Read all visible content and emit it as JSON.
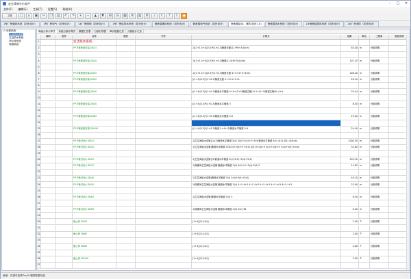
{
  "window": {
    "title": "宏业清单计价软件"
  },
  "menu": [
    "文件(F)",
    "编辑(E)",
    "工具(T)",
    "设置(S)",
    "帮助(H)"
  ],
  "toolbar": {
    "first_label": "工程",
    "buttons": [
      "new-icon",
      "open-icon",
      "save-icon",
      "cut-icon",
      "copy-icon",
      "paste-icon",
      "undo-icon",
      "redo-icon",
      "insert-row-icon",
      "delete-row-icon",
      "move-up-icon",
      "move-down-icon",
      "expand-icon",
      "collapse-icon",
      "calculator-icon",
      "report-icon",
      "chart-icon",
      "settings-icon",
      "search-icon",
      "pointer-icon",
      "help-icon",
      "export-icon",
      "orange-tool-icon"
    ]
  },
  "project_tabs": [
    {
      "label": "1号厂房通风系统（初步设计）",
      "active": false
    },
    {
      "label": "1号厂房电气（初步设计）",
      "active": false
    },
    {
      "label": "1#厂房照明（初步设计）",
      "active": false
    },
    {
      "label": "1号厂房给排水系统（初步设计）",
      "active": false
    },
    {
      "label": "宿舍楼通风系统（初步设计）",
      "active": false
    },
    {
      "label": "宿舍楼电气系统（初步设计）",
      "active": false
    },
    {
      "label": "宿舍楼给水、消防(初步1.0)",
      "active": true
    },
    {
      "label": "宿舍楼排水系统（初步设计）",
      "active": false
    },
    {
      "label": "2#宿舍楼排风系统（初步设计）",
      "active": false
    },
    {
      "label": "2#厂房消防（初步设计）",
      "active": false
    }
  ],
  "tree": [
    {
      "label": "分部系统",
      "level": 0,
      "selected": false
    },
    {
      "label": "生活给水系统",
      "level": 1,
      "selected": true
    },
    {
      "label": "生活热水系统",
      "level": 1,
      "selected": false
    },
    {
      "label": "消火栓系统",
      "level": 1,
      "selected": false
    },
    {
      "label": "喷淋系统",
      "level": 1,
      "selected": false
    }
  ],
  "sub_tabs": [
    {
      "label": "明细分部计算式",
      "active": true
    },
    {
      "label": "系统分部计算式",
      "active": false
    },
    {
      "label": "数据汇总表",
      "active": false
    },
    {
      "label": "分部分项表",
      "active": false
    },
    {
      "label": "单价措施汇总",
      "active": false
    },
    {
      "label": "分部统计汇总",
      "active": false
    }
  ],
  "columns": [
    "",
    "编码",
    "图号",
    "名称",
    "楼层",
    "代号",
    "计算式",
    "结果",
    "单位",
    "工程量",
    "图纸说明"
  ],
  "rows": [
    {
      "n": "1",
      "name": "生活给水系统",
      "name_style": "red",
      "formula": "",
      "result": "",
      "unit": "",
      "qty": ""
    },
    {
      "n": "2",
      "name": "PP-R管管道安装 DN15",
      "name_style": "green",
      "formula": "1[(1+1.5+4)/2.5]*(1+0.3)管道长度(2) 5*6+3(5)(m)",
      "result": "85.40",
      "unit": "m",
      "qty": "分部说明"
    },
    {
      "n": "3",
      "name": "",
      "name_style": "",
      "formula": "",
      "result": "",
      "unit": "",
      "qty": ""
    },
    {
      "n": "4",
      "name": "PP-R管管道安装 DN20",
      "name_style": "green",
      "formula": "1[(1+1.5+4)/2.5]*(1+0.3)管道(1) 5(6+3(4))(m)",
      "result": "107.25",
      "unit": "m",
      "qty": "分部说明"
    },
    {
      "n": "5",
      "name": "",
      "name_style": "",
      "formula": "",
      "result": "",
      "unit": "",
      "qty": ""
    },
    {
      "n": "6",
      "name": "PP-R管管道安装 DN25",
      "name_style": "green",
      "formula": "1[(1+1.5+4)/2.5]*(1+0.3)管道长度 4+4+4+4+4(m)",
      "result": "100.40",
      "unit": "m",
      "qty": "分部说明"
    },
    {
      "n": "7",
      "name": "PP-R管管道安装 DN32",
      "name_style": "green",
      "formula": "[(1+4)/2.5]*(1+0.3)管道长度 4+4+4+4+4",
      "result": "28.70",
      "unit": "m",
      "qty": "分部说明"
    },
    {
      "n": "8",
      "name": "",
      "name_style": "",
      "formula": "",
      "result": "",
      "unit": "",
      "qty": ""
    },
    {
      "n": "9",
      "name": "PP-R管管道安装 DN40",
      "name_style": "green",
      "formula": "[(1+4)/2.5]*(1+0.3)管道水平管道 4+4+(5+3)管道立管(3) 3+(5+3)管道立管(8) 4+4",
      "result": "35.44",
      "unit": "m",
      "qty": "分部说明"
    },
    {
      "n": "10",
      "name": "",
      "name_style": "",
      "formula": "",
      "result": "",
      "unit": "",
      "qty": ""
    },
    {
      "n": "11",
      "name": "PP-R管管道安装 DN50",
      "name_style": "green",
      "formula": "[(1+4)/2.5]*(1+0.3)管道水平管道 3",
      "result": "8.50",
      "unit": "m",
      "qty": "分部说明"
    },
    {
      "n": "12",
      "name": "",
      "name_style": "",
      "formula": "",
      "result": "",
      "unit": "",
      "qty": ""
    },
    {
      "n": "13",
      "name": "PP-R管管道安装 DN65",
      "name_style": "green",
      "formula": "[(1+4)/2.5]*(1+0.3)管道水平管道 5.6",
      "result": "23.40",
      "unit": "m",
      "qty": "分部说明"
    },
    {
      "n": "14",
      "name": "",
      "name_style": "",
      "formula": "",
      "result": "",
      "unit": "",
      "qty": "",
      "highlight": true
    },
    {
      "n": "15",
      "name": "PP-R管管道安装 DN100",
      "name_style": "green",
      "formula": "[(1+4)/2.5]*(1+0.3)管道 4+4+(3)管道水平管道 5.6",
      "result": "29.40",
      "unit": "m",
      "qty": "分部说明"
    },
    {
      "n": "16",
      "name": "",
      "name_style": "",
      "formula": "",
      "result": "",
      "unit": "",
      "qty": ""
    },
    {
      "n": "17",
      "name": "PP-R管(热水) DN15",
      "name_style": "green",
      "formula": "1[卫生间给水支管](1)(3)管道水平管道 3(4) 5(4)+5(4)+5+5(4)管道水平管道 4(5) 4(5) 4(5) 4(5)(m)",
      "result": "1000.50",
      "unit": "m",
      "qty": "分部说明"
    },
    {
      "n": "18",
      "name": "PP-R管(热水) DN20",
      "name_style": "green",
      "formula": "1[卫生间给水支管]管道水平管道 4(5)(4)+5(4)+5+5(4) 4(5)+5(4)+5 5(4)+5(4)+5 5(4)+5(4)+5(m)",
      "result": "34.80",
      "unit": "m",
      "qty": "分部说明"
    },
    {
      "n": "19",
      "name": "",
      "name_style": "",
      "formula": "",
      "result": "",
      "unit": "",
      "qty": ""
    },
    {
      "n": "20",
      "name": "PP-R管(热水) DN25",
      "name_style": "green",
      "formula": "1[卫生间给水支管](3)管道水平管道 3(4) 5(4)+5(4)+5(4)",
      "result": "295.10",
      "unit": "m",
      "qty": "分部说明"
    },
    {
      "n": "21",
      "name": "PP-R管(热水) DN32",
      "name_style": "green",
      "formula": "1[电梯间卫生间给水支管]管道水平管道 3(4) 5(4)+5+5(4) 8(4) 5",
      "result": "14.82",
      "unit": "m",
      "qty": "分部说明"
    },
    {
      "n": "22",
      "name": "",
      "name_style": "",
      "formula": "",
      "result": "",
      "unit": "",
      "qty": ""
    },
    {
      "n": "23",
      "name": "PP-R管(热水) DN40",
      "name_style": "green",
      "formula": "1[卫生间给水支管]管道水平管道 3(4) 5(4)+5(4)+5(4)",
      "result": "40.10",
      "unit": "m",
      "qty": "分部说明"
    },
    {
      "n": "24",
      "name": "PP-R管(热水) DN50",
      "name_style": "green",
      "formula": "1[电梯间卫生间给水支管]管道水平管道 3(4) 4+5 4+5 4+5 4+5 4+5 4+5 4+5 4+5 4+5 4+5",
      "result": "23.90",
      "unit": "m",
      "qty": "分部说明"
    },
    {
      "n": "25",
      "name": "",
      "name_style": "",
      "formula": "",
      "result": "",
      "unit": "",
      "qty": ""
    },
    {
      "n": "26",
      "name": "PP-R管(热水) DN65",
      "name_style": "green",
      "formula": "1[卫生间给水支管]管道水平管道 3(4) 5",
      "result": "8.40",
      "unit": "m",
      "qty": "分部说明"
    },
    {
      "n": "27",
      "name": "",
      "name_style": "",
      "formula": "",
      "result": "",
      "unit": "",
      "qty": ""
    },
    {
      "n": "28",
      "name": "PP-R管(热水) DN80",
      "name_style": "green",
      "formula": "1[电梯间卫生间给水支管]管道水平管道 3(4) 5(4) 36",
      "result": "0.50",
      "unit": "m",
      "qty": "分部说明"
    },
    {
      "n": "29",
      "name": "",
      "name_style": "",
      "formula": "",
      "result": "",
      "unit": "",
      "qty": ""
    },
    {
      "n": "30",
      "name": "截止阀 DN50",
      "name_style": "green",
      "formula": "[1+4][1(1)(2)]",
      "result": "2.00",
      "unit": "个",
      "qty": "分部说明"
    },
    {
      "n": "31",
      "name": "",
      "name_style": "",
      "formula": "",
      "result": "",
      "unit": "",
      "qty": ""
    },
    {
      "n": "32",
      "name": "截止阀 DN65",
      "name_style": "green",
      "formula": "[1+4][1(1)(2)]",
      "result": "2.00",
      "unit": "个",
      "qty": "分部说明"
    },
    {
      "n": "33",
      "name": "",
      "name_style": "",
      "formula": "",
      "result": "",
      "unit": "",
      "qty": ""
    },
    {
      "n": "34",
      "name": "截止阀 DN80",
      "name_style": "green",
      "formula": "[1+4][1(1)(2)]",
      "result": "2.00",
      "unit": "个",
      "qty": "分部说明"
    },
    {
      "n": "35",
      "name": "",
      "name_style": "",
      "formula": "",
      "result": "",
      "unit": "",
      "qty": ""
    },
    {
      "n": "36",
      "name": "截止阀 DN100",
      "name_style": "green",
      "formula": "[1+4][1(1)(2)]",
      "result": "2.00",
      "unit": "个",
      "qty": "分部说明"
    },
    {
      "n": "37",
      "name": "",
      "name_style": "",
      "formula": "",
      "result": "",
      "unit": "",
      "qty": ""
    }
  ],
  "status": {
    "text": "就绪：右键可选择Dw/XL辅助数据功能"
  }
}
